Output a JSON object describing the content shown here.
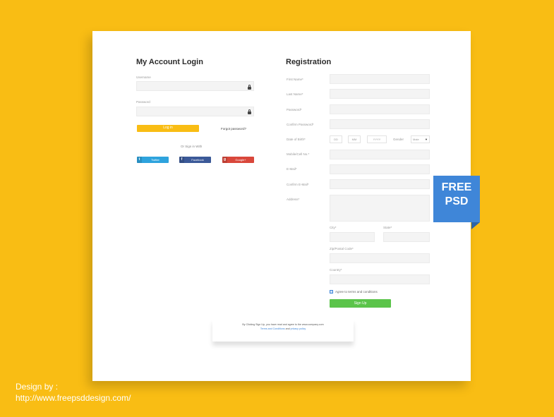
{
  "login": {
    "title": "My Account Login",
    "username_label": "Username",
    "password_label": "Password",
    "login_button": "Log in",
    "forgot_link": "Forgot password?",
    "or_sign_in_with": "Or Sign in With",
    "social": [
      {
        "label": "Twitter",
        "color": "#2EA3DD",
        "icon": "twitter-icon"
      },
      {
        "label": "Facebook",
        "color": "#3B5998",
        "icon": "facebook-icon"
      },
      {
        "label": "Google+",
        "color": "#D9473B",
        "icon": "google-plus-icon"
      }
    ]
  },
  "registration": {
    "title": "Registration",
    "fields": {
      "first_name": "First Name*",
      "last_name": "Last Name*",
      "password": "Password*",
      "confirm_password": "Confirm Password*",
      "dob": "Date of Birth*",
      "mobile": "Mobile/Cell No.*",
      "email": "E-Mail*",
      "confirm_email": "Confirm E-Mail*",
      "address": "Address*",
      "city": "City*",
      "state": "State*",
      "zip": "Zip/Postal Code*",
      "country": "Country*"
    },
    "dob_day": "DD",
    "dob_month": "MM",
    "dob_year": "YYYY",
    "gender_label": "Gender",
    "gender_value": "Male",
    "agree_text": "Agree to terms and conditions",
    "signup_button": "Sign Up",
    "signup_color": "#5BC44A"
  },
  "note": {
    "line1": "By Clicking Sign Up, you have read and agree to the www.company.com",
    "terms_link": "Terms and Conditions",
    "and": "and",
    "privacy_link": "privacy policy"
  },
  "ribbon": {
    "line1": "FREE",
    "line2": "PSD"
  },
  "credit": {
    "line1": "Design by :",
    "line2": "http://www.freepsddesign.com/"
  },
  "colors": {
    "background": "#F9BD14",
    "login_button": "#F9BD14",
    "ribbon": "#3F86D8"
  }
}
